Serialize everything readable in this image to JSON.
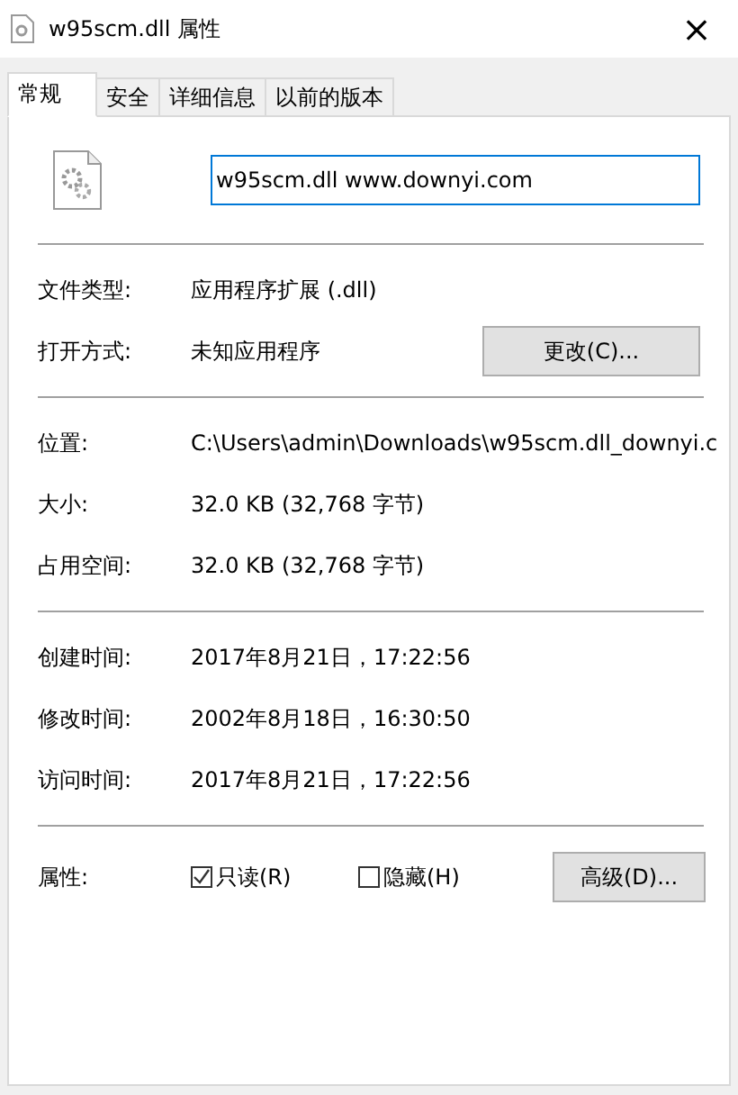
{
  "window": {
    "title": "w95scm.dll 属性",
    "close": "×"
  },
  "tabs": [
    {
      "label": "常规",
      "selected": true
    },
    {
      "label": "安全",
      "selected": false
    },
    {
      "label": "详细信息",
      "selected": false
    },
    {
      "label": "以前的版本",
      "selected": false
    }
  ],
  "file_name": {
    "value": "w95scm.dll www.downyi.com"
  },
  "sections": [
    {
      "rows": [
        {
          "label": "文件类型:",
          "value": "应用程序扩展 (.dll)"
        },
        {
          "label": "打开方式:",
          "value": "未知应用程序",
          "button": "更改(C)..."
        }
      ]
    },
    {
      "rows": [
        {
          "label": "位置:",
          "value": "C:\\Users\\admin\\Downloads\\w95scm.dll_downyi.c"
        },
        {
          "label": "大小:",
          "value": "32.0 KB (32,768 字节)"
        },
        {
          "label": "占用空间:",
          "value": "32.0 KB (32,768 字节)"
        }
      ]
    },
    {
      "rows": [
        {
          "label": "创建时间:",
          "value": "2017年8月21日，17:22:56"
        },
        {
          "label": "修改时间:",
          "value": "2002年8月18日，16:30:50"
        },
        {
          "label": "访问时间:",
          "value": "2017年8月21日，17:22:56"
        }
      ]
    }
  ],
  "attributes": {
    "label": "属性:",
    "checkboxes": [
      {
        "label": "只读(R)",
        "checked": true
      },
      {
        "label": "隐藏(H)",
        "checked": false
      }
    ],
    "button": "高级(D)..."
  }
}
